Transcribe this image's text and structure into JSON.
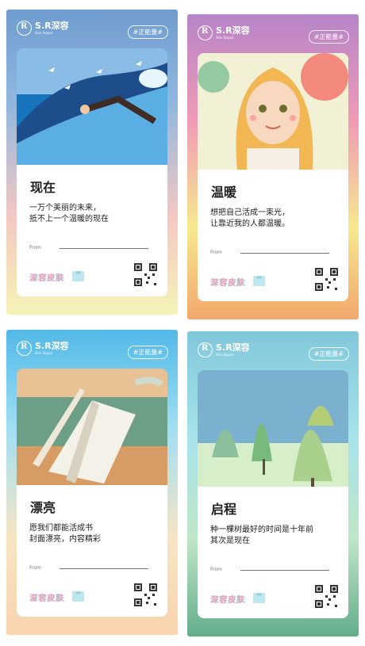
{
  "brand": {
    "mark": "R",
    "name": "S.R深容",
    "subtitle": "Skin Repair"
  },
  "tag": "#正能量#",
  "from_label": "From",
  "footer_brand": "深容皮肤",
  "mini_qr_text": "扫码",
  "posters": [
    {
      "title": "现在",
      "line1": "一万个美丽的未来，",
      "line2": "抵不上一个温暖的现在",
      "scene": "swimmer"
    },
    {
      "title": "温暖",
      "line1": "想把自己活成一束光，",
      "line2": "让靠近我的人都温暖。",
      "scene": "girl"
    },
    {
      "title": "漂亮",
      "line1": "愿我们都能活成书",
      "line2": "封面漂亮，内容精彩",
      "scene": "book"
    },
    {
      "title": "启程",
      "line1": "种一棵树最好的时间是十年前",
      "line2": "其次是现在",
      "scene": "trees"
    }
  ],
  "colors": {
    "accent_yellow": "#ffe85a",
    "text": "#222222",
    "brand_pink": "#f0a2b8",
    "brand_blue": "#9fd7e8"
  }
}
